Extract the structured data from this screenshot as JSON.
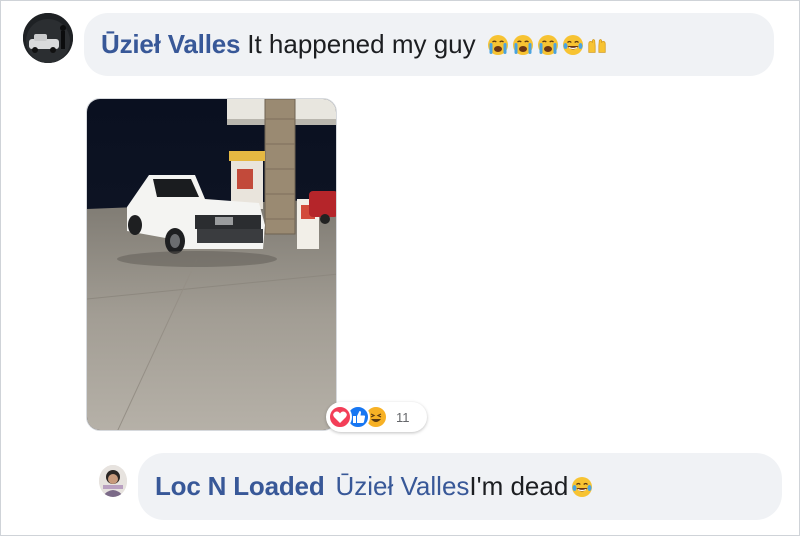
{
  "comments": [
    {
      "author": "Ūzieł Valles",
      "text": "It happened my guy",
      "emojis": [
        "loudly-crying-face-icon",
        "loudly-crying-face-icon",
        "loudly-crying-face-icon",
        "face-with-tears-of-joy-icon",
        "raising-hands-icon"
      ],
      "reactions": {
        "types": [
          "love-reaction-icon",
          "like-reaction-icon",
          "haha-reaction-icon"
        ],
        "count": "11"
      }
    },
    {
      "author": "Loc N Loaded",
      "mention": "Ūzieł Valles",
      "text": "I'm dead",
      "emojis": [
        "face-with-tears-of-joy-icon"
      ]
    }
  ],
  "colors": {
    "author_link": "#385898",
    "bubble_bg": "#f0f2f5",
    "love": "#f33e58",
    "like": "#1877f2",
    "haha": "#f7b125"
  }
}
